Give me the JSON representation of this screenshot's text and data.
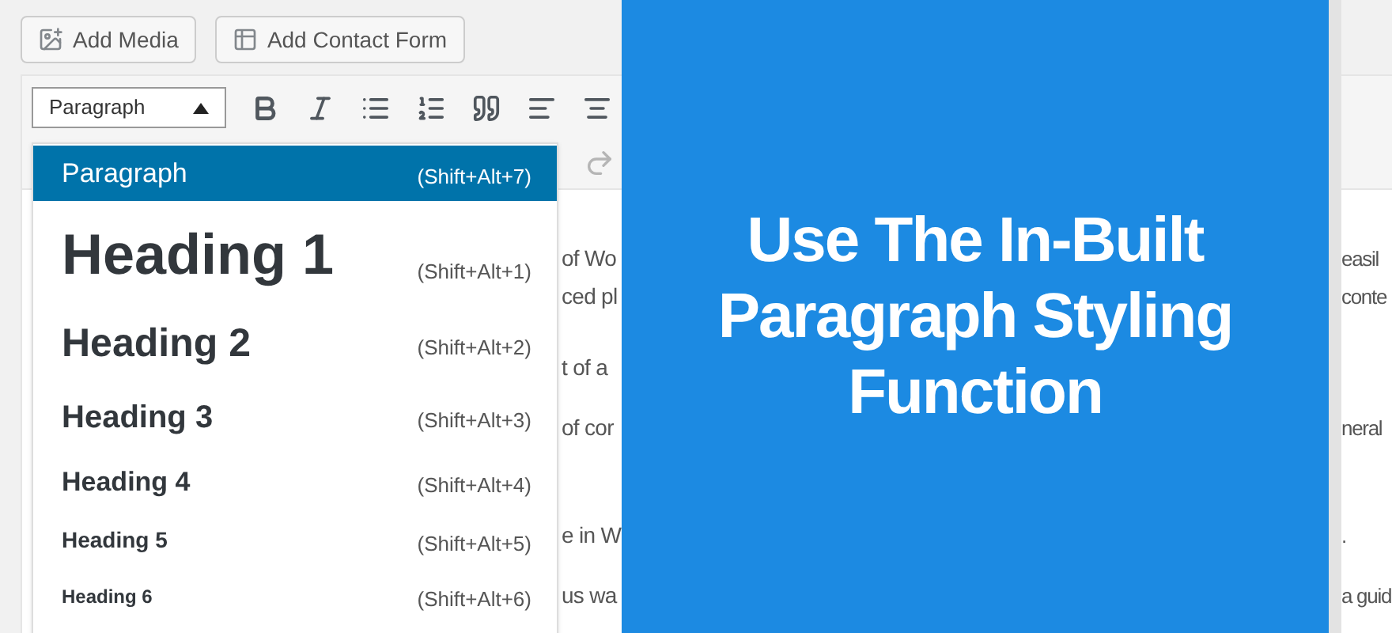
{
  "media_buttons": [
    {
      "kind": "media",
      "label": "Add Media"
    },
    {
      "kind": "form",
      "label": "Add Contact Form"
    }
  ],
  "format_select": {
    "value": "Paragraph",
    "expanded": true
  },
  "format_menu": [
    {
      "kind": "p",
      "label": "Paragraph",
      "shortcut": "(Shift+Alt+7)",
      "selected": true
    },
    {
      "kind": "h1",
      "label": "Heading 1",
      "shortcut": "(Shift+Alt+1)",
      "selected": false
    },
    {
      "kind": "h2",
      "label": "Heading 2",
      "shortcut": "(Shift+Alt+2)",
      "selected": false
    },
    {
      "kind": "h3",
      "label": "Heading 3",
      "shortcut": "(Shift+Alt+3)",
      "selected": false
    },
    {
      "kind": "h4",
      "label": "Heading 4",
      "shortcut": "(Shift+Alt+4)",
      "selected": false
    },
    {
      "kind": "h5",
      "label": "Heading 5",
      "shortcut": "(Shift+Alt+5)",
      "selected": false
    },
    {
      "kind": "h6",
      "label": "Heading 6",
      "shortcut": "(Shift+Alt+6)",
      "selected": false
    }
  ],
  "content_lines": [
    {
      "left": "of Wo",
      "right": "easil"
    },
    {
      "left": "ced pl",
      "right": "conte"
    },
    {
      "left": "t of a"
    },
    {
      "left": "of cor",
      "right": "neral"
    },
    {
      "left": "e in W",
      "right": "."
    },
    {
      "left": "us wa",
      "right": "a guid"
    }
  ],
  "banner": {
    "title": "Use The In-Built Paragraph Styling Function"
  }
}
